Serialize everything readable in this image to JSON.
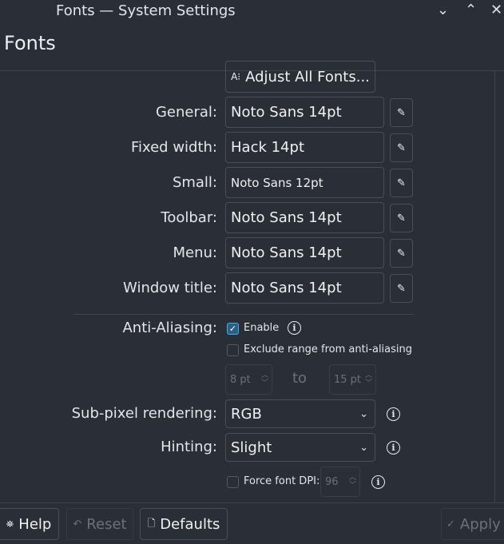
{
  "window": {
    "title": "Fonts — System Settings",
    "minimize": "⌄",
    "maximize": "⌃",
    "close": "✕"
  },
  "page_title": "Fonts",
  "adjust_all": {
    "icon": "A⁝",
    "label": "Adjust All Fonts..."
  },
  "font_rows": [
    {
      "label": "General:",
      "value": "Noto Sans 14pt"
    },
    {
      "label": "Fixed width:",
      "value": "Hack  14pt"
    },
    {
      "label": "Small:",
      "value": "Noto Sans 12pt"
    },
    {
      "label": "Toolbar:",
      "value": "Noto Sans 14pt"
    },
    {
      "label": "Menu:",
      "value": "Noto Sans 14pt"
    },
    {
      "label": "Window title:",
      "value": "Noto Sans 14pt"
    }
  ],
  "anti_aliasing": {
    "label": "Anti-Aliasing:",
    "enable_label": "Enable",
    "enabled": true,
    "exclude_label": "Exclude range from anti-aliasing",
    "exclude_checked": false,
    "range_from": "8 pt",
    "range_to_label": "to",
    "range_to": "15 pt"
  },
  "subpixel": {
    "label": "Sub-pixel rendering:",
    "value": "RGB"
  },
  "hinting": {
    "label": "Hinting:",
    "value": "Slight"
  },
  "force_dpi": {
    "label": "Force font DPI:",
    "checked": false,
    "value": "96"
  },
  "footer": {
    "help": "Help",
    "reset": "Reset",
    "defaults": "Defaults",
    "apply": "Apply"
  }
}
